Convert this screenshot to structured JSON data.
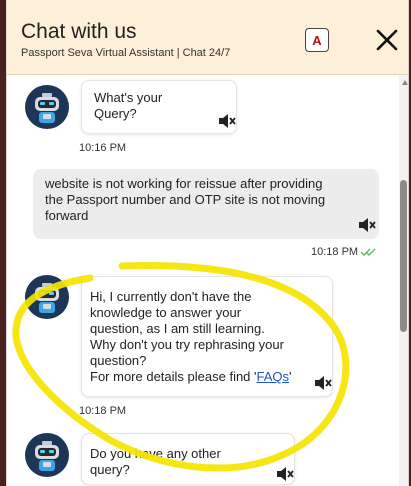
{
  "header": {
    "title": "Chat with us",
    "subtitle": "Passport Seva Virtual Assistant | Chat 24/7",
    "font_button_label": "A",
    "icons": {
      "font_size": "font-size-icon",
      "close": "close-icon"
    }
  },
  "messages": [
    {
      "sender": "bot",
      "lines": [
        "What's your",
        "Query?"
      ],
      "time": "10:16 PM"
    },
    {
      "sender": "user",
      "lines": [
        "website is not working for reissue after providing",
        "the Passport number and OTP site is not moving",
        "forward"
      ],
      "time": "10:18 PM",
      "status_icon": "double-check-icon"
    },
    {
      "sender": "bot",
      "lines": [
        "Hi, I currently don't have the",
        "knowledge to answer your",
        "question, as I am still learning.",
        "Why don't you try rephrasing your",
        "question?"
      ],
      "last_line_prefix": "For more details please find '",
      "link_text": "FAQs",
      "last_line_suffix": "'",
      "time": "10:18 PM"
    },
    {
      "sender": "bot",
      "lines": [
        "Do you have any other",
        "query?"
      ]
    }
  ],
  "colors": {
    "header_bg": "#fdefd8",
    "link": "#1a55c0",
    "read_check": "#5cb85c",
    "highlight": "#f5e400",
    "avatar_bg": "#1d3658"
  }
}
